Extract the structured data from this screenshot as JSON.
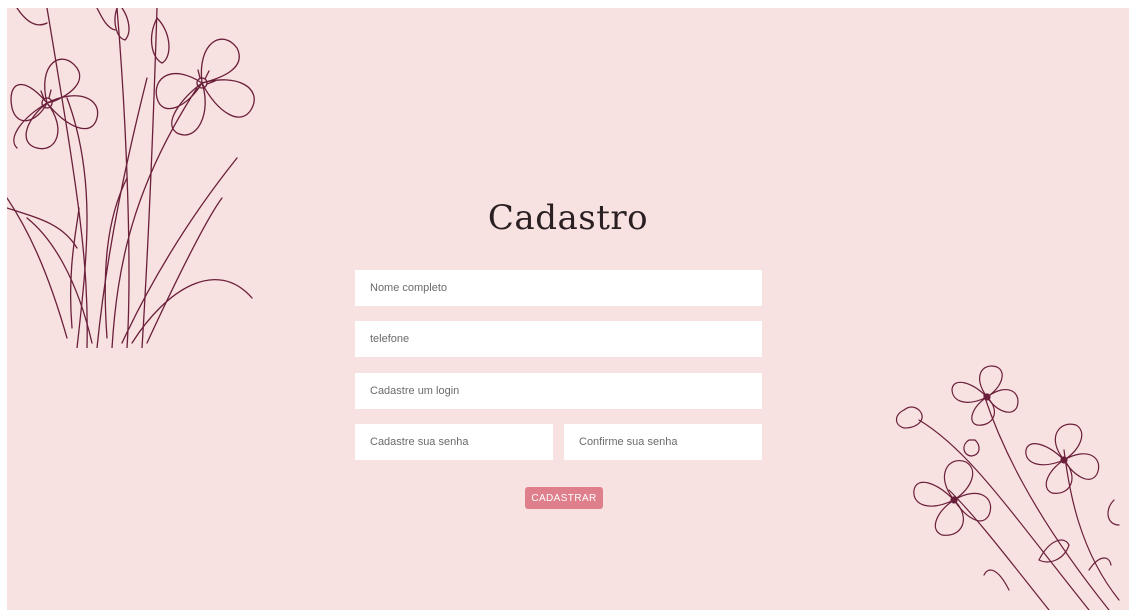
{
  "page": {
    "title": "Cadastro",
    "background_color": "#f7e1e1",
    "accent_color": "#de7f8b",
    "illustration_color": "#6b1f3a"
  },
  "form": {
    "full_name_placeholder": "Nome completo",
    "phone_placeholder": "telefone",
    "login_placeholder": "Cadastre um login",
    "password_placeholder": "Cadastre sua senha",
    "confirm_password_placeholder": "Confirme sua senha",
    "submit_label": "CADASTRAR"
  },
  "decorations": {
    "top_left": "flower-bouquet-illustration",
    "bottom_right": "flower-branch-illustration"
  }
}
